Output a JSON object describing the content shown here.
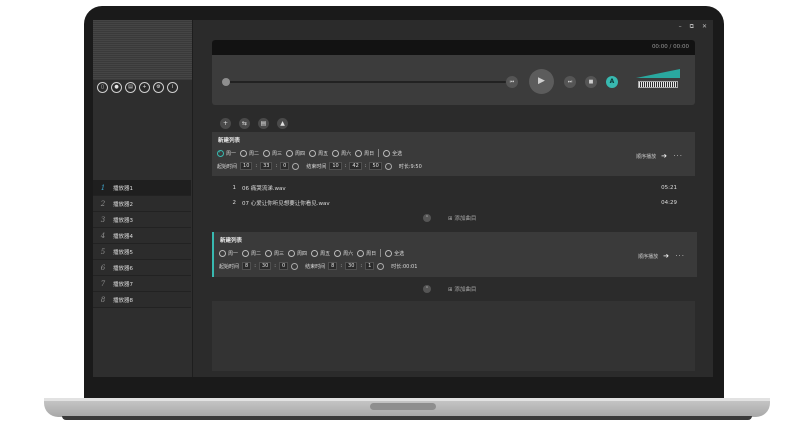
{
  "window_controls": [
    "–",
    "⧉",
    "✕"
  ],
  "sidebar": {
    "tool_icons": [
      "file-icon",
      "record-icon",
      "save-icon",
      "add-icon",
      "settings-icon",
      "info-icon"
    ],
    "tool_glyphs": [
      "▯",
      "●",
      "▤",
      "+",
      "⚙",
      "i"
    ],
    "playlists": [
      {
        "num": "1",
        "label": "播放器1",
        "active": true
      },
      {
        "num": "2",
        "label": "播放器2"
      },
      {
        "num": "3",
        "label": "播放器3"
      },
      {
        "num": "4",
        "label": "播放器4"
      },
      {
        "num": "5",
        "label": "播放器5"
      },
      {
        "num": "6",
        "label": "播放器6"
      },
      {
        "num": "7",
        "label": "播放器7"
      },
      {
        "num": "8",
        "label": "播放器8"
      }
    ]
  },
  "player": {
    "time": "00:00 / 00:00",
    "progress": 0,
    "buttons": {
      "prev": "⏮",
      "play": "▶",
      "next": "⏭",
      "stop": "■",
      "mode": "A"
    }
  },
  "toolbar": [
    "+",
    "⇆",
    "▤",
    "▲"
  ],
  "schedules": [
    {
      "title": "新建列表",
      "days": [
        "周一",
        "周二",
        "周三",
        "周四",
        "周五",
        "周六",
        "周日"
      ],
      "checked": [
        true,
        false,
        false,
        false,
        false,
        false,
        false
      ],
      "select_all": "全选",
      "start_label": "起始时间",
      "start": [
        "10",
        "33",
        "0"
      ],
      "end_label": "结束时间",
      "end": [
        "10",
        "42",
        "50"
      ],
      "duration": "时长:9:50",
      "sort": "顺序播放",
      "more": "···"
    },
    {
      "title": "新建列表",
      "days": [
        "周一",
        "周二",
        "周三",
        "周四",
        "周五",
        "周六",
        "周日"
      ],
      "checked": [
        false,
        false,
        false,
        false,
        false,
        false,
        false
      ],
      "select_all": "全选",
      "start_label": "起始时间",
      "start": [
        "8",
        "30",
        "0"
      ],
      "end_label": "结束时间",
      "end": [
        "8",
        "30",
        "1"
      ],
      "duration": "时长:00:01",
      "sort": "顺序播放",
      "more": "···"
    }
  ],
  "songs": [
    {
      "idx": "1",
      "title": "06 痛哭流涕.wav",
      "dur": "05:21"
    },
    {
      "idx": "2",
      "title": "07 心爱让你听见想要让你看见.wav",
      "dur": "04:29"
    }
  ],
  "add_song": "添加曲目",
  "colors": {
    "accent": "#38b9b0",
    "highlight": "#40a8d0"
  }
}
